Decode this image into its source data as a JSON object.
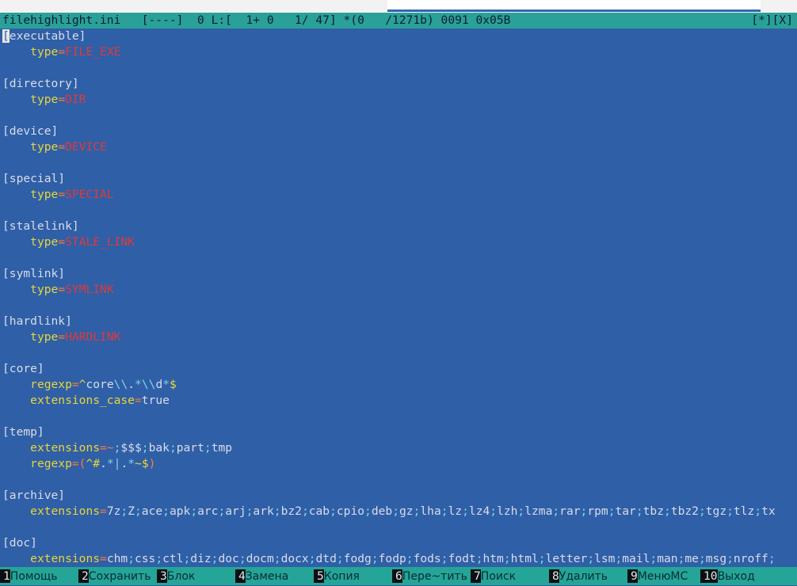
{
  "window": {
    "top_tab_hint": "…"
  },
  "status": {
    "left": "filehighlight.ini   [----]  0 L:[  1+ 0   1/ 47] *(0   /1271b) 0091 0x05B",
    "right": "[*][X]"
  },
  "editor": {
    "cursor_char": "[",
    "lines": [
      {
        "type": "section",
        "text": "executable]"
      },
      {
        "type": "kv",
        "key": "type",
        "value": "FILE_EXE",
        "value_style": "red"
      },
      {
        "type": "blank"
      },
      {
        "type": "section",
        "text": "[directory]"
      },
      {
        "type": "kv",
        "key": "type",
        "value": "DIR",
        "value_style": "red"
      },
      {
        "type": "blank"
      },
      {
        "type": "section",
        "text": "[device]"
      },
      {
        "type": "kv",
        "key": "type",
        "value": "DEVICE",
        "value_style": "red"
      },
      {
        "type": "blank"
      },
      {
        "type": "section",
        "text": "[special]"
      },
      {
        "type": "kv",
        "key": "type",
        "value": "SPECIAL",
        "value_style": "red"
      },
      {
        "type": "blank"
      },
      {
        "type": "section",
        "text": "[stalelink]"
      },
      {
        "type": "kv",
        "key": "type",
        "value": "STALE_LINK",
        "value_style": "red"
      },
      {
        "type": "blank"
      },
      {
        "type": "section",
        "text": "[symlink]"
      },
      {
        "type": "kv",
        "key": "type",
        "value": "SYMLINK",
        "value_style": "red"
      },
      {
        "type": "blank"
      },
      {
        "type": "section",
        "text": "[hardlink]"
      },
      {
        "type": "kv",
        "key": "type",
        "value": "HARDLINK",
        "value_style": "red"
      },
      {
        "type": "blank"
      },
      {
        "type": "section",
        "text": "[core]"
      },
      {
        "type": "kv",
        "key": "regexp",
        "value": "^core\\\\.*\\\\d*$",
        "value_style": "regex"
      },
      {
        "type": "kv",
        "key": "extensions_case",
        "value": "true",
        "value_style": "plain"
      },
      {
        "type": "blank"
      },
      {
        "type": "section",
        "text": "[temp]"
      },
      {
        "type": "kv",
        "key": "extensions",
        "value": "~;$$$;bak;part;tmp",
        "value_style": "list"
      },
      {
        "type": "kv",
        "key": "regexp",
        "value": "(^#.*|.*~$)",
        "value_style": "regex"
      },
      {
        "type": "blank"
      },
      {
        "type": "section",
        "text": "[archive]"
      },
      {
        "type": "kv",
        "key": "extensions",
        "value": "7z;Z;ace;apk;arc;arj;ark;bz2;cab;cpio;deb;gz;lha;lz;lz4;lzh;lzma;rar;rpm;tar;tbz;tbz2;tgz;tlz;tx",
        "value_style": "list"
      },
      {
        "type": "blank"
      },
      {
        "type": "section",
        "text": "[doc]"
      },
      {
        "type": "kv",
        "key": "extensions",
        "value": "chm;css;ctl;diz;doc;docm;docx;dtd;fodg;fodp;fods;fodt;htm;html;letter;lsm;mail;man;me;msg;nroff;",
        "value_style": "list"
      }
    ]
  },
  "fkeys": [
    {
      "num": "1",
      "label": "Помощь"
    },
    {
      "num": "2",
      "label": "Сохранить"
    },
    {
      "num": "3",
      "label": "Блок"
    },
    {
      "num": "4",
      "label": "Замена"
    },
    {
      "num": "5",
      "label": "Копия"
    },
    {
      "num": "6",
      "label": "Пере~тить"
    },
    {
      "num": "7",
      "label": "Поиск"
    },
    {
      "num": "8",
      "label": "Удалить"
    },
    {
      "num": "9",
      "label": "МенюMC"
    },
    {
      "num": "10",
      "label": "Выход"
    }
  ],
  "colors": {
    "editor_bg": "#2f5fa7",
    "statusbar_bg": "#2aa198",
    "key": "#e8d63a",
    "red_value": "#e03a3a",
    "separator": "#7fd4e8"
  }
}
